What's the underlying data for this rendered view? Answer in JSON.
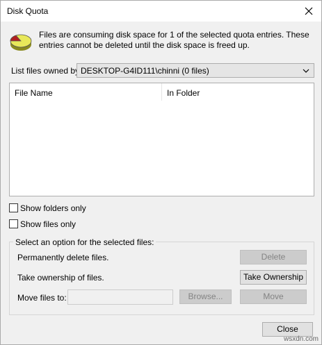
{
  "window": {
    "title": "Disk Quota",
    "close_icon": "close-icon"
  },
  "info": {
    "icon": "disk-pie-icon",
    "message": "Files are consuming disk space for 1 of the selected quota entries.  These entries cannot be deleted until the disk space is freed up."
  },
  "owner": {
    "label": "List files owned by:",
    "selected": "DESKTOP-G4ID111\\chinni (0 files)"
  },
  "list": {
    "columns": [
      "File Name",
      "In Folder"
    ],
    "rows": []
  },
  "filters": {
    "show_folders_only": "Show folders only",
    "show_files_only": "Show files only"
  },
  "actions": {
    "group_title": "Select an option for the selected files:",
    "delete_label": "Permanently delete files.",
    "delete_button": "Delete",
    "ownership_label": "Take ownership of files.",
    "ownership_button": "Take Ownership",
    "move_label": "Move files to:",
    "move_value": "",
    "browse_button": "Browse...",
    "move_button": "Move"
  },
  "footer": {
    "close_button": "Close",
    "watermark": "wsxdn.com"
  },
  "colors": {
    "pie_yellow": "#e8e85a",
    "pie_red": "#b02020",
    "window_bg": "#f0f0f0"
  }
}
